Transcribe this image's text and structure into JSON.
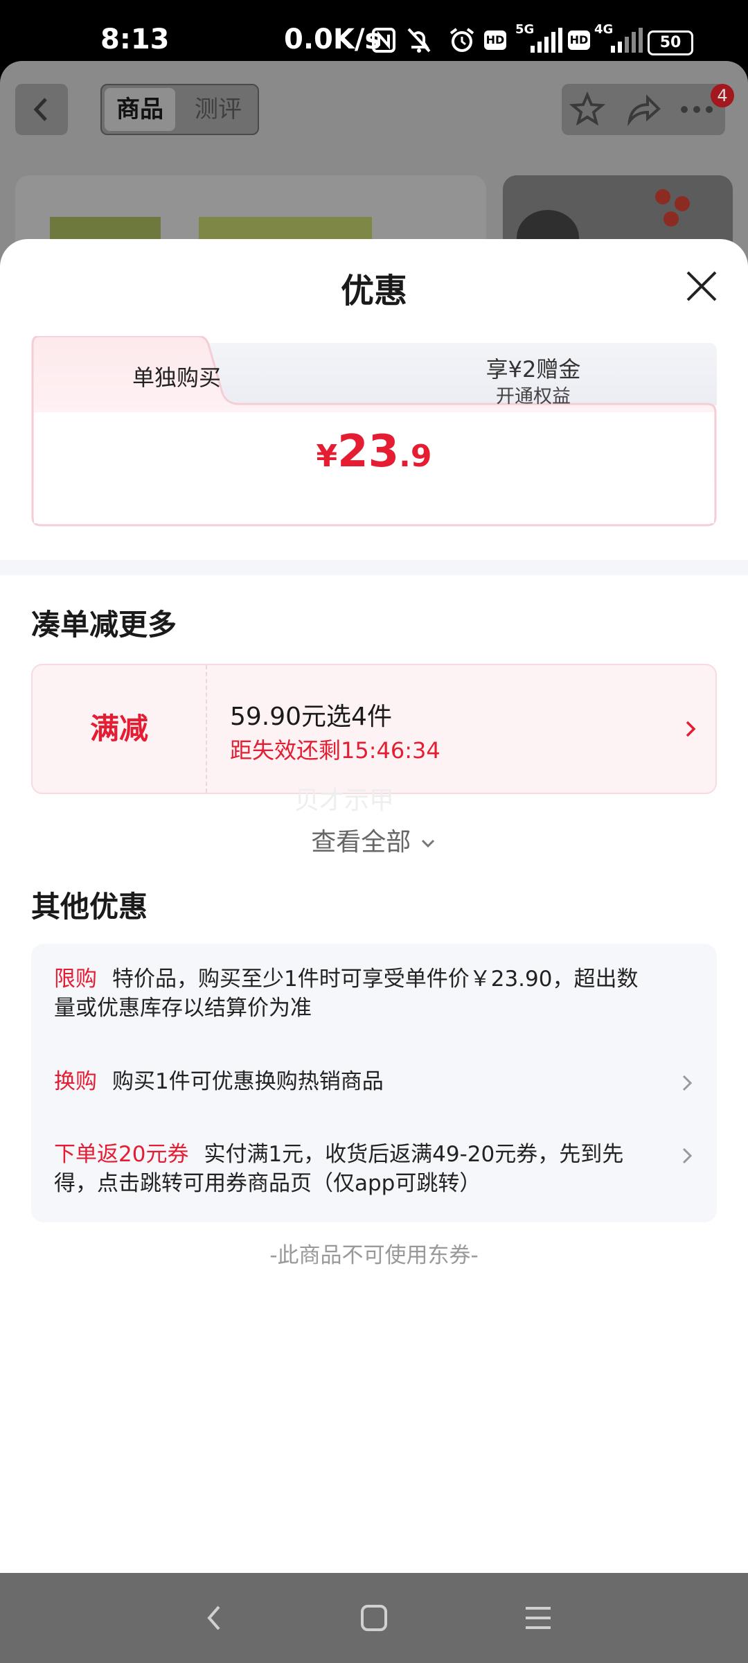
{
  "status_bar": {
    "time": "8:13",
    "net_speed": "0.0K/s",
    "hd1": "HD",
    "net1": "5G",
    "hd2": "HD",
    "net2": "4G",
    "battery": "50",
    "icons": [
      "nfc-icon",
      "mute-icon",
      "alarm-icon",
      "hd-icon",
      "signal-icon",
      "hd-icon",
      "signal-icon",
      "battery-icon"
    ]
  },
  "background_page": {
    "tabs": [
      "商品",
      "测评"
    ],
    "badge_count": "4"
  },
  "sheet": {
    "title": "优惠",
    "price_tabs": {
      "active": "单独购买",
      "inactive": "享¥2赠金",
      "inactive_sub": "开通权益"
    },
    "price": {
      "currency": "¥",
      "integer": "23",
      "decimal": ".9"
    },
    "bundle_section": {
      "heading": "凑单减更多",
      "promo_tag": "满减",
      "promo_title": "59.90元选4件",
      "promo_timer": "距失效还剩15:46:34",
      "see_all": "查看全部",
      "watermark": "贝才示甲"
    },
    "other_section": {
      "heading": "其他优惠",
      "items": [
        {
          "tag": "限购",
          "line1": "特价品，购买至少1件时可享受单件价￥23.90，超出数",
          "line2": "量或优惠库存以结算价为准"
        },
        {
          "tag": "换购",
          "line1": "购买1件可优惠换购热销商品"
        },
        {
          "tag": "下单返20元券",
          "line1": "实付满1元，收货后返满49-20元券，先到先",
          "line2": "得，点击跳转可用券商品页（仅app可跳转）"
        }
      ],
      "note": "-此商品不可使用东券-"
    }
  },
  "colors": {
    "accent": "#e41d33",
    "promo_bg": "#fdf3f4",
    "box_bg": "#f6f7fb"
  }
}
